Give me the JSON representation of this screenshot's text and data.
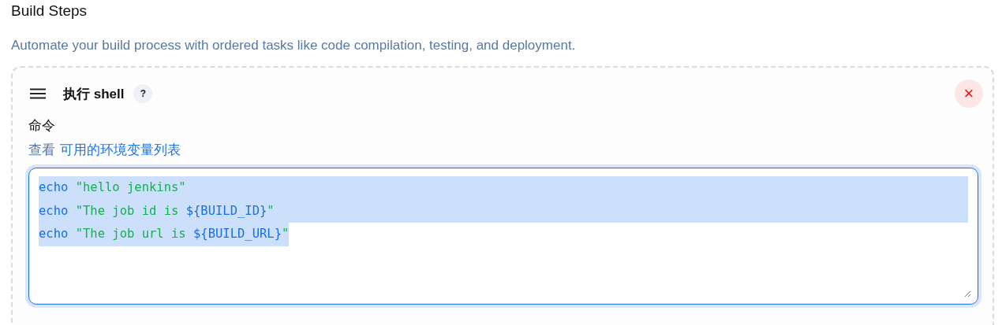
{
  "section": {
    "title": "Build Steps",
    "description": "Automate your build process with ordered tasks like code compilation, testing, and deployment."
  },
  "step": {
    "title": "执行 shell",
    "help": "?",
    "close": "×",
    "field_label": "命令",
    "hint_prefix": "查看",
    "hint_link": "可用的环境变量列表",
    "code_lines": [
      {
        "selected": true,
        "tokens": [
          {
            "kind": "keyword",
            "text": "echo "
          },
          {
            "kind": "string",
            "text": "\"hello jenkins\""
          }
        ]
      },
      {
        "selected": true,
        "tokens": [
          {
            "kind": "keyword",
            "text": "echo "
          },
          {
            "kind": "string",
            "text": "\"The job id is "
          },
          {
            "kind": "variable",
            "text": "${BUILD_ID}"
          },
          {
            "kind": "string",
            "text": "\""
          }
        ]
      },
      {
        "selected": true,
        "tokens": [
          {
            "kind": "keyword",
            "text": "echo "
          },
          {
            "kind": "string",
            "text": "\"The job url is "
          },
          {
            "kind": "variable",
            "text": "${BUILD_URL}"
          },
          {
            "kind": "string",
            "text": "\""
          }
        ]
      }
    ]
  }
}
